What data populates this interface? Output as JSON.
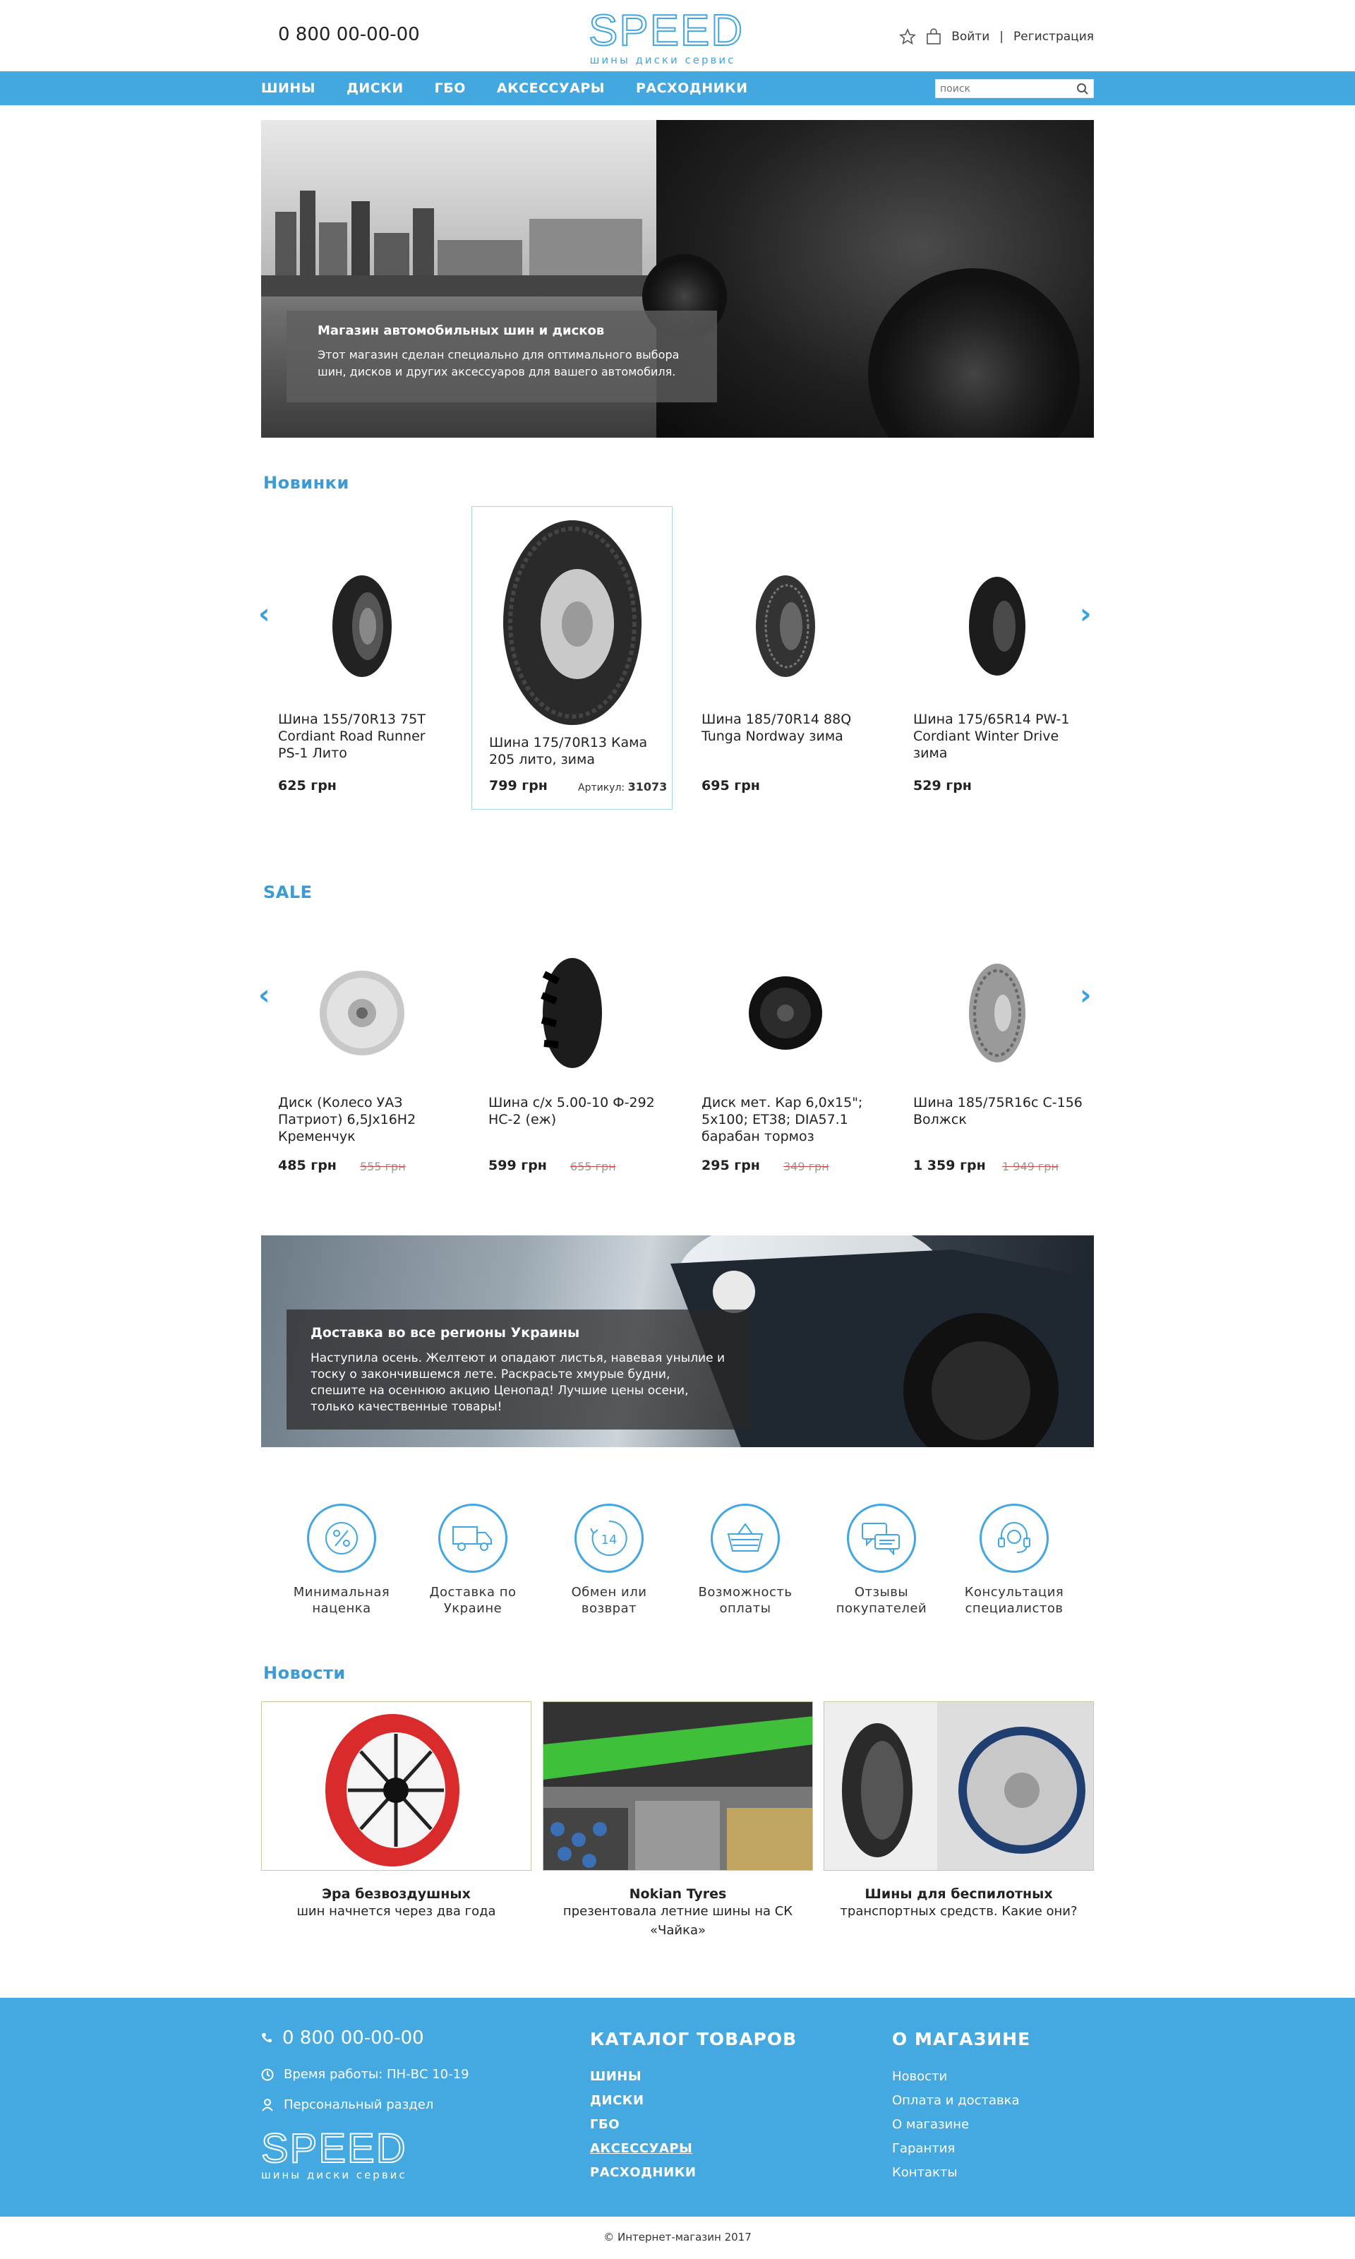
{
  "header": {
    "phone": "0 800 00-00-00",
    "logo_word": "SPEED",
    "logo_sub": "шины диски сервис",
    "login": "Войти",
    "separator": "|",
    "register": "Регистрация"
  },
  "nav": {
    "items": [
      "ШИНЫ",
      "ДИСКИ",
      "ГБО",
      "АКСЕССУАРЫ",
      "РАСХОДНИКИ"
    ],
    "search_placeholder": "поиск"
  },
  "hero": {
    "title": "Магазин автомобильных шин и дисков",
    "text": "Этот магазин сделан специально для оптимального выбора шин, дисков и других аксессуаров для вашего автомобиля."
  },
  "new_section": {
    "title": "Новинки",
    "products": [
      {
        "name": "Шина 155/70R13 75T Cordiant Road Runner PS-1 Лито",
        "price": "625 грн"
      },
      {
        "name": "Шина 175/70R13 Кама 205 лито, зима",
        "price": "799 грн",
        "article_label": "Артикул:",
        "article": "31073"
      },
      {
        "name": "Шина 185/70R14 88Q Tunga Nordway зима",
        "price": "695 грн"
      },
      {
        "name": "Шина 175/65R14 PW-1 Cordiant Winter Drive зима",
        "price": "529 грн"
      }
    ]
  },
  "sale_section": {
    "title": "SALE",
    "products": [
      {
        "name": "Диск (Колесо УАЗ Патриот) 6,5Jx16H2 Кременчук",
        "price": "485 грн",
        "old_price": "555 грн"
      },
      {
        "name": "Шина с/х 5.00-10 Ф-292 НС-2 (еж)",
        "price": "599 грн",
        "old_price": "655 грн"
      },
      {
        "name": "Диск мет. Кар 6,0x15\"; 5x100; ET38; DIA57.1 барабан тормоз",
        "price": "295 грн",
        "old_price": "349 грн"
      },
      {
        "name": "Шина 185/75R16с С-156 Волжск",
        "price": "1 359 грн",
        "old_price": "1 949 грн"
      }
    ]
  },
  "banner": {
    "title": "Доставка во все регионы Украины",
    "text": "Наступила осень. Желтеют и опадают листья, навевая унылие и тоску о закончившемся лете. Раскрасьте хмурые будни, спешите на осеннюю акцию Ценопад! Лучшие цены осени, только качественные товары!"
  },
  "features": [
    {
      "label": "Минимальная наценка",
      "icon": "percent-icon"
    },
    {
      "label": "Доставка по Украине",
      "icon": "truck-icon"
    },
    {
      "label": "Обмен или возврат",
      "icon": "return-14-icon",
      "badge": "14"
    },
    {
      "label": "Возможность оплаты",
      "icon": "basket-icon"
    },
    {
      "label": "Отзывы покупателей",
      "icon": "chat-icon"
    },
    {
      "label": "Консультация специалистов",
      "icon": "headset-icon"
    }
  ],
  "news_section": {
    "title": "Новости",
    "items": [
      {
        "title": "Эра безвоздушных",
        "desc": "шин начнется через два года"
      },
      {
        "title": "Nokian Tyres",
        "desc": "презентовала летние шины на СК «Чайка»"
      },
      {
        "title": "Шины для беспилотных",
        "desc": "транспортных средств. Какие они?"
      }
    ]
  },
  "footer": {
    "phone": "0 800 00-00-00",
    "hours": "Время работы: ПН-ВС 10-19",
    "personal": "Персональный раздел",
    "logo_word": "SPEED",
    "logo_sub": "шины диски сервис",
    "catalog_title": "КАТАЛОГ ТОВАРОВ",
    "catalog": [
      "ШИНЫ",
      "ДИСКИ",
      "ГБО",
      "АКСЕССУАРЫ",
      "РАСХОДНИКИ"
    ],
    "about_title": "О МАГАЗИНЕ",
    "about": [
      "Новости",
      "Оплата и доставка",
      "О магазине",
      "Гарантия",
      "Контакты"
    ]
  },
  "copyright": "© Интернет-магазин 2017",
  "colors": {
    "accent": "#43a7e0",
    "footer": "#44a8e1",
    "title": "#3a9bd6"
  }
}
